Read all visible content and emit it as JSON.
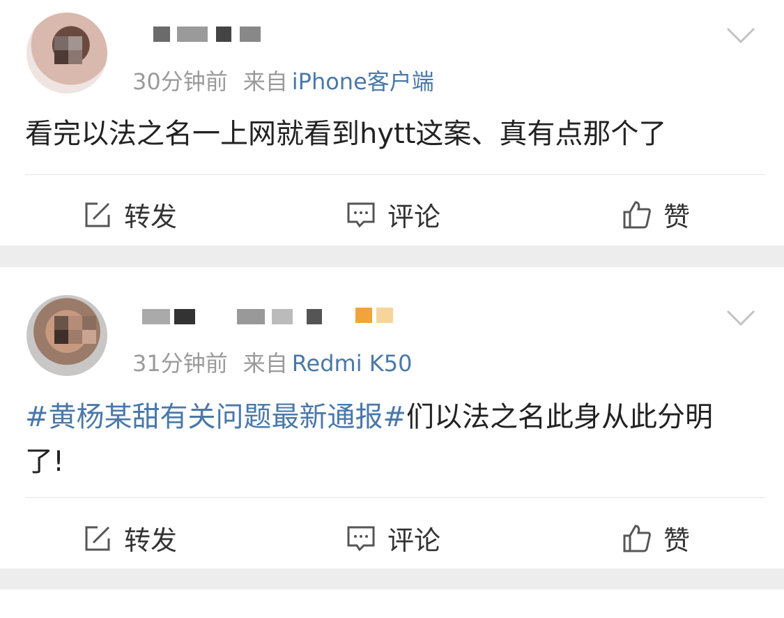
{
  "posts": [
    {
      "author": "",
      "time": "30分钟前",
      "from": "来自",
      "source": "iPhone客户端",
      "text": "看完以法之名一上网就看到hytt这案、真有点那个了",
      "actions": {
        "repost": "转发",
        "comment": "评论",
        "like": "赞"
      }
    },
    {
      "author": "",
      "time": "31分钟前",
      "from": "来自",
      "source": "Redmi K50",
      "topic": "#黄杨某甜有关问题最新通报#",
      "text": "们以法之名此身从此分明了!",
      "actions": {
        "repost": "转发",
        "comment": "评论",
        "like": "赞"
      }
    }
  ],
  "icons": {
    "repost": "edit-box-icon",
    "comment": "chat-bubble-icon",
    "like": "thumbs-up-icon",
    "menu": "chevron-down-icon"
  },
  "colors": {
    "link": "#4a78a8",
    "meta": "#9a9a9a",
    "text": "#222222",
    "bg": "#ededed"
  }
}
